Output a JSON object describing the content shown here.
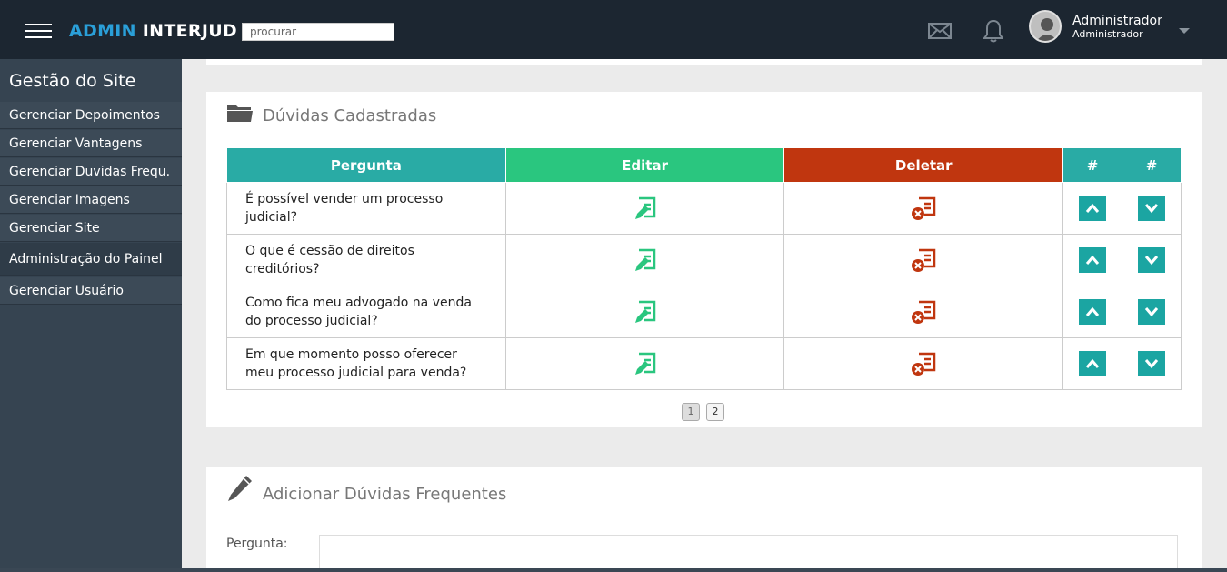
{
  "header": {
    "brand_part1": "ADMIN",
    "brand_part2": "INTERJUD",
    "search_placeholder": "procurar",
    "user_name": "Administrador",
    "user_role": "Administrador"
  },
  "sidebar": {
    "title": "Gestão do Site",
    "items": [
      {
        "label": "Gerenciar Depoimentos"
      },
      {
        "label": "Gerenciar Vantagens"
      },
      {
        "label": "Gerenciar Duvidas Frequ."
      },
      {
        "label": "Gerenciar Imagens"
      },
      {
        "label": "Gerenciar Site"
      }
    ],
    "section": "Administração do Painel",
    "section_items": [
      {
        "label": "Gerenciar Usuário"
      }
    ]
  },
  "faq_panel": {
    "title": "Dúvidas Cadastradas",
    "columns": [
      "Pergunta",
      "Editar",
      "Deletar",
      "#",
      "#"
    ],
    "rows": [
      {
        "question": "É possível vender um processo judicial?"
      },
      {
        "question": "O que é cessão de direitos creditórios?"
      },
      {
        "question": "Como fica meu advogado na venda do processo judicial?"
      },
      {
        "question": "Em que momento posso oferecer meu processo judicial para venda?"
      }
    ],
    "pages": [
      "1",
      "2"
    ]
  },
  "add_panel": {
    "title": "Adicionar Dúvidas Frequentes",
    "label_pergunta": "Pergunta:"
  },
  "colors": {
    "topbar": "#1c2631",
    "sidebar": "#364451",
    "teal": "#29aba5",
    "green": "#2ac67f",
    "red": "#c0360f",
    "brand_blue": "#2a9fd8"
  },
  "icons": {
    "menu": "hamburger-icon",
    "mail": "mail-icon",
    "bell": "bell-icon",
    "folder": "folder-icon",
    "pencil": "pencil-icon",
    "edit": "edit-document-icon",
    "delete": "delete-document-icon",
    "up": "chevron-up-icon",
    "down": "chevron-down-icon"
  }
}
